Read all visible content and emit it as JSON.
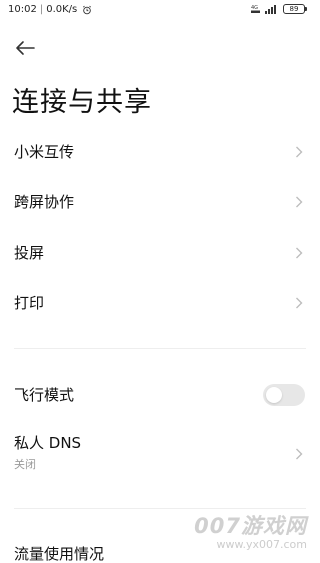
{
  "status_bar": {
    "time": "10:02",
    "speed": "0.0K/s",
    "network": "4G",
    "battery": "89"
  },
  "header": {
    "title": "连接与共享"
  },
  "items": [
    {
      "label": "小米互传"
    },
    {
      "label": "跨屏协作"
    },
    {
      "label": "投屏"
    },
    {
      "label": "打印"
    }
  ],
  "airplane": {
    "label": "飞行模式",
    "enabled": false
  },
  "private_dns": {
    "label": "私人 DNS",
    "status": "关闭"
  },
  "traffic": {
    "label": "流量使用情况"
  },
  "watermark": {
    "main": "007游戏网",
    "sub": "www.yx007.com"
  },
  "colors": {
    "toggle_off": "#e7e7e7",
    "chevron": "#bdbdbd",
    "divider": "#eeeeee",
    "subtext": "#9a9a9a"
  }
}
